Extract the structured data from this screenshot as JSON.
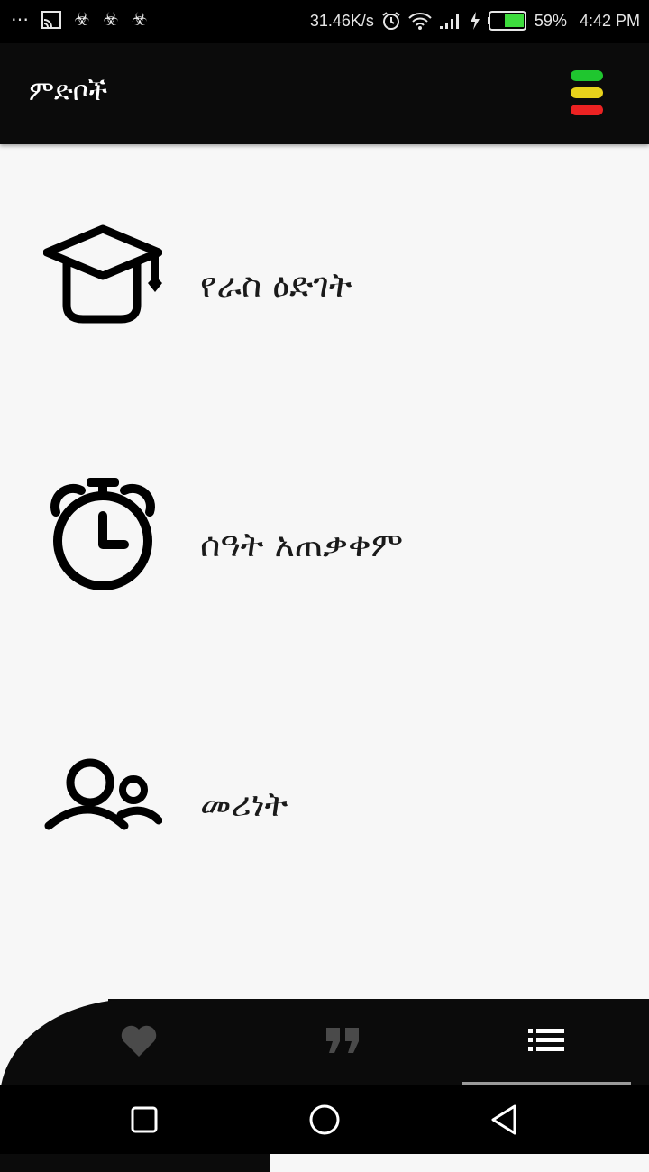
{
  "status_bar": {
    "net_speed": "31.46K/s",
    "battery_percent": "59%",
    "time": "4:42 PM",
    "left_icons": [
      "more-dots-icon",
      "cast-icon",
      "ethiopian-cross-icon",
      "ethiopian-cross-icon",
      "ethiopian-cross-icon"
    ],
    "battery_level": 0.59,
    "battery_color": "#3ddc3d"
  },
  "app_bar": {
    "title": "ምድቦች",
    "flag_colors": [
      "#1fc62f",
      "#e8d21b",
      "#ec2222"
    ]
  },
  "menu": {
    "items": [
      {
        "icon": "graduation-cap-icon",
        "label": "የራስ ዕድገት"
      },
      {
        "icon": "stopwatch-icon",
        "label": "ሰዓት አጠቃቀም"
      },
      {
        "icon": "people-icon",
        "label": "መሪነት"
      }
    ]
  },
  "bottom_nav": {
    "items": [
      {
        "icon": "heart-icon",
        "selected": false
      },
      {
        "icon": "quote-icon",
        "selected": false
      },
      {
        "icon": "list-icon",
        "selected": true
      }
    ]
  },
  "system_nav": [
    "square-icon",
    "circle-icon",
    "back-triangle-icon"
  ]
}
